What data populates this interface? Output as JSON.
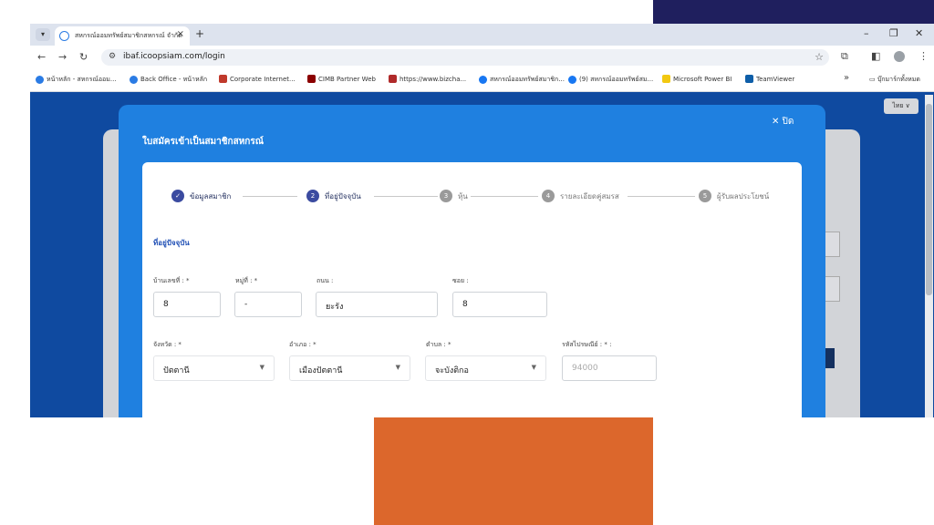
{
  "browser": {
    "tab_title": "สหกรณ์ออมทรัพย์สมาชิกสหกรณ์ จำกัด",
    "url": "ibaf.icoopsiam.com/login",
    "bookmarks": [
      {
        "label": "หน้าหลัก - สหกรณ์ออม...",
        "color": "#2a7be4"
      },
      {
        "label": "Back Office - หน้าหลัก",
        "color": "#2a7be4"
      },
      {
        "label": "Corporate Internet...",
        "color": "#c0392b"
      },
      {
        "label": "CIMB Partner Web",
        "color": "#8b0000"
      },
      {
        "label": "https://www.bizcha...",
        "color": "#b02a2a"
      },
      {
        "label": "สหกรณ์ออมทรัพย์สมาชิก...",
        "color": "#1877f2"
      },
      {
        "label": "(9) สหกรณ์ออมทรัพย์สม...",
        "color": "#1877f2"
      },
      {
        "label": "Microsoft Power BI",
        "color": "#f2c811"
      },
      {
        "label": "TeamViewer",
        "color": "#0e5ea8"
      }
    ],
    "bookmarks_folder": "บุ๊กมาร์กทั้งหมด",
    "lang_selector": "ไทย ∨"
  },
  "modal": {
    "title": "ใบสมัครเข้าเป็นสมาชิกสหกรณ์",
    "close_label": "✕  ปิด",
    "steps": [
      {
        "num": "✓",
        "label": "ข้อมูลสมาชิก",
        "state": "done"
      },
      {
        "num": "2",
        "label": "ที่อยู่ปัจจุบัน",
        "state": "active"
      },
      {
        "num": "3",
        "label": "หุ้น",
        "state": "idle"
      },
      {
        "num": "4",
        "label": "รายละเอียดคู่สมรส",
        "state": "idle"
      },
      {
        "num": "5",
        "label": "ผู้รับผลประโยชน์",
        "state": "idle"
      }
    ],
    "section_title": "ที่อยู่ปัจจุบัน",
    "fields": {
      "house_no": {
        "label": "บ้านเลขที่ : *",
        "value": "8"
      },
      "moo": {
        "label": "หมู่ที่ : *",
        "value": "-"
      },
      "road": {
        "label": "ถนน :",
        "value": "ยะรัง"
      },
      "soi": {
        "label": "ซอย :",
        "value": "8"
      },
      "province": {
        "label": "จังหวัด : *",
        "value": "ปัตตานี"
      },
      "district": {
        "label": "อำเภอ : *",
        "value": "เมืองปัตตานี"
      },
      "subdistrict": {
        "label": "ตำบล : *",
        "value": "จะบังติกอ"
      },
      "postcode": {
        "label": "รหัสไปรษณีย์ : * :",
        "placeholder": "94000"
      }
    }
  }
}
